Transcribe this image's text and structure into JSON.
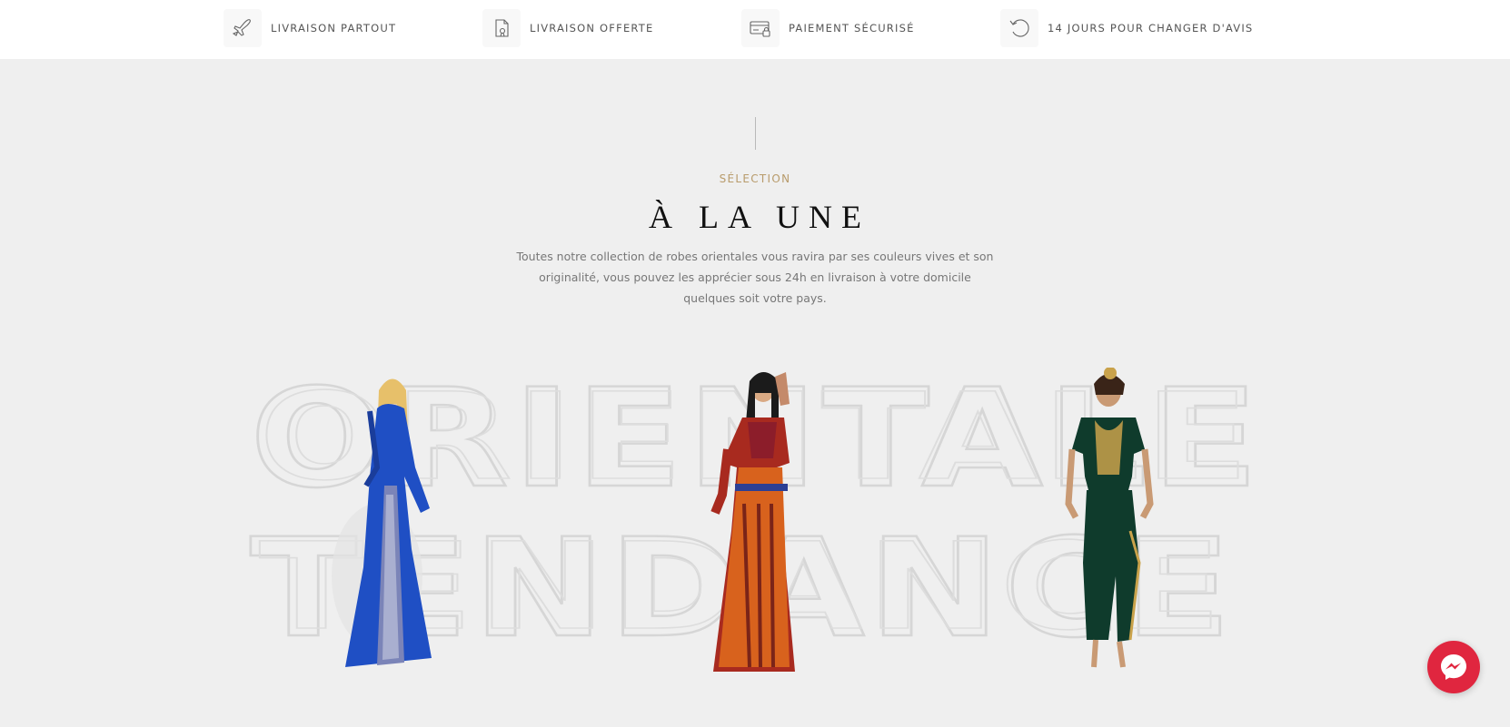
{
  "features": [
    {
      "label": "LIVRAISON PARTOUT",
      "icon": "airplane-icon"
    },
    {
      "label": "LIVRAISON OFFERTE",
      "icon": "gift-certificate-icon"
    },
    {
      "label": "PAIEMENT SÉCURISÉ",
      "icon": "secure-card-icon"
    },
    {
      "label": "14 JOURS POUR CHANGER D'AVIS",
      "icon": "return-arrow-icon"
    }
  ],
  "section": {
    "eyebrow": "SÉLECTION",
    "title": "À LA UNE",
    "intro": "Toutes notre collection de robes orientales vous ravira par ses couleurs vives et son originalité, vous pouvez les apprécier sous 24h en livraison à votre domicile quelques soit votre pays."
  },
  "backdrop": {
    "line1": "ORIENTALE",
    "line2": "TENDANCE"
  },
  "products": [
    {
      "name": "blue-caftan-product",
      "color": "#1f4fc4"
    },
    {
      "name": "kabyle-dress-product",
      "color": "#c4441f"
    },
    {
      "name": "green-velvet-dress-product",
      "color": "#0f3b2c"
    }
  ],
  "chat": {
    "icon": "messenger-icon",
    "color": "#e0263f"
  }
}
